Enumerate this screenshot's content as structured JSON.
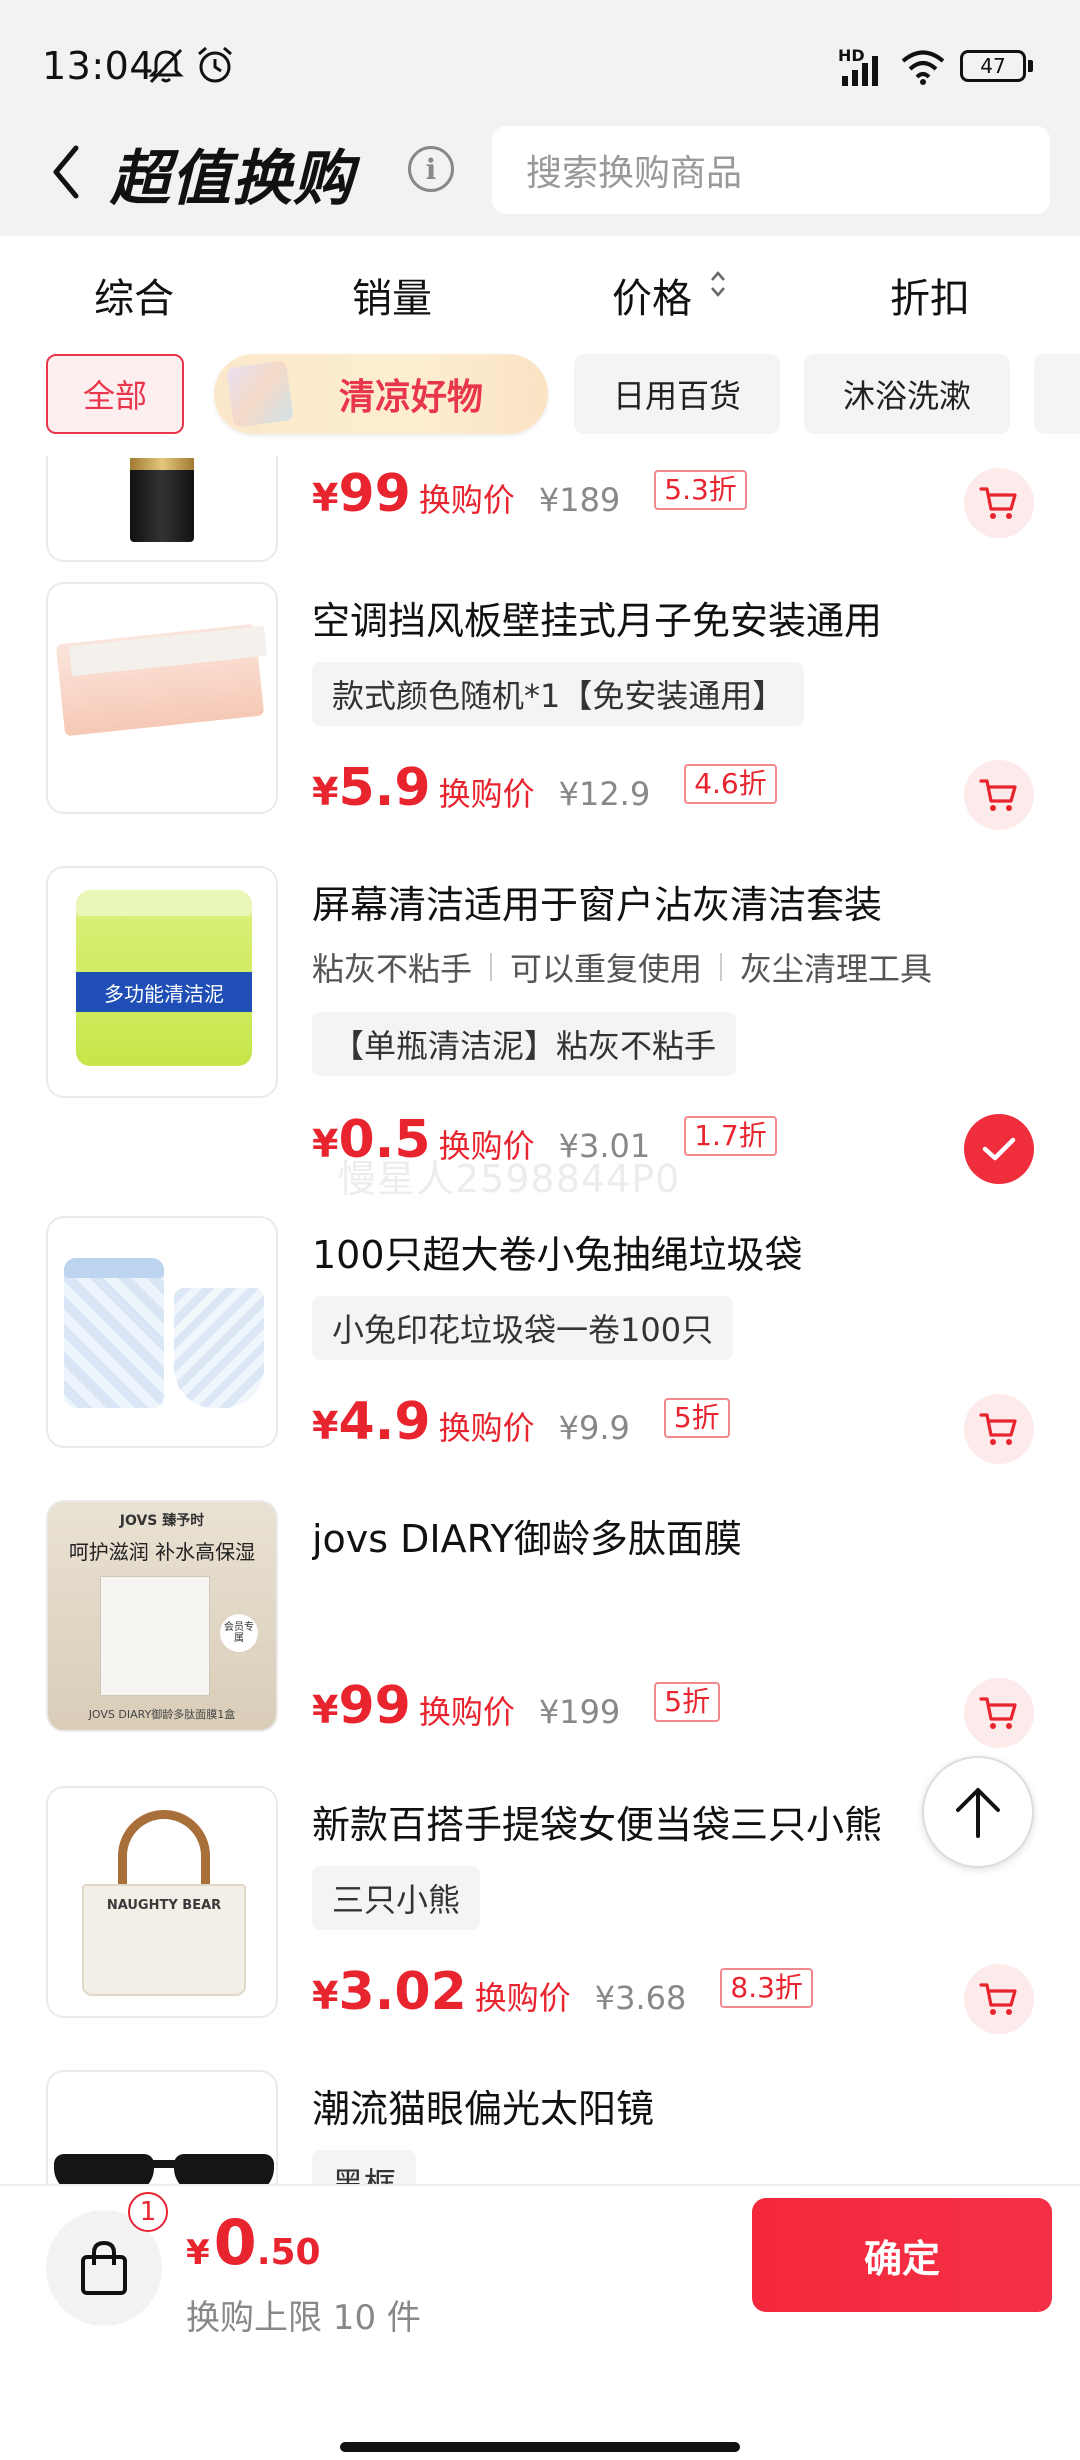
{
  "status": {
    "time": "13:04",
    "network": "HD",
    "battery": "47"
  },
  "header": {
    "title": "超值换购",
    "search_placeholder": "搜索换购商品"
  },
  "sort": {
    "items": [
      "综合",
      "销量",
      "价格",
      "折扣"
    ]
  },
  "chips": [
    "全部",
    "清凉好物",
    "日用百货",
    "沐浴洗漱"
  ],
  "products": [
    {
      "title": "",
      "specs": [],
      "features": [],
      "price": "99",
      "price_label": "换购价",
      "orig": "¥189",
      "discount": "5.3折",
      "action": "cart"
    },
    {
      "title": "空调挡风板壁挂式月子免安装通用",
      "specs": [
        "款式颜色随机*1【免安装通用】"
      ],
      "features": [],
      "price": "5.9",
      "price_label": "换购价",
      "orig": "¥12.9",
      "discount": "4.6折",
      "action": "cart"
    },
    {
      "title": "屏幕清洁适用于窗户沾灰清洁套装",
      "specs": [
        "【单瓶清洁泥】粘灰不粘手"
      ],
      "features": [
        "粘灰不粘手",
        "可以重复使用",
        "灰尘清理工具"
      ],
      "price": "0.5",
      "price_label": "换购价",
      "orig": "¥3.01",
      "discount": "1.7折",
      "action": "checked"
    },
    {
      "title": "100只超大卷小兔抽绳垃圾袋",
      "specs": [
        "小兔印花垃圾袋一卷100只"
      ],
      "features": [],
      "price": "4.9",
      "price_label": "换购价",
      "orig": "¥9.9",
      "discount": "5折",
      "action": "cart"
    },
    {
      "title": "jovs DIARY御龄多肽面膜",
      "specs": [],
      "features": [],
      "price": "99",
      "price_label": "换购价",
      "orig": "¥199",
      "discount": "5折",
      "action": "cart"
    },
    {
      "title": "新款百搭手提袋女便当袋三只小熊",
      "specs": [
        "三只小熊"
      ],
      "features": [],
      "price": "3.02",
      "price_label": "换购价",
      "orig": "¥3.68",
      "discount": "8.3折",
      "action": "cart"
    },
    {
      "title": "潮流猫眼偏光太阳镜",
      "specs": [
        "黑框"
      ],
      "features": [],
      "price": "",
      "price_label": "",
      "orig": "",
      "discount": "",
      "action": ""
    }
  ],
  "thumb_text": {
    "cleaner": "多功能清洁泥",
    "mask_brand": "JOVS 臻予时",
    "mask_slogan": "呵护滋润 补水高保湿",
    "mask_tag": "会员专属",
    "mask_caption": "JOVS DIARY御龄多肽面膜1盒",
    "bag_text": "NAUGHTY BEAR"
  },
  "watermark": "慢星人2598844P0",
  "bottom": {
    "cart_count": "1",
    "currency": "¥",
    "total_int": "0",
    "total_dec": ".50",
    "limit": "换购上限 10 件",
    "confirm": "确定"
  },
  "colors": {
    "accent": "#e8242f",
    "confirm_bg": "#f4283c"
  }
}
